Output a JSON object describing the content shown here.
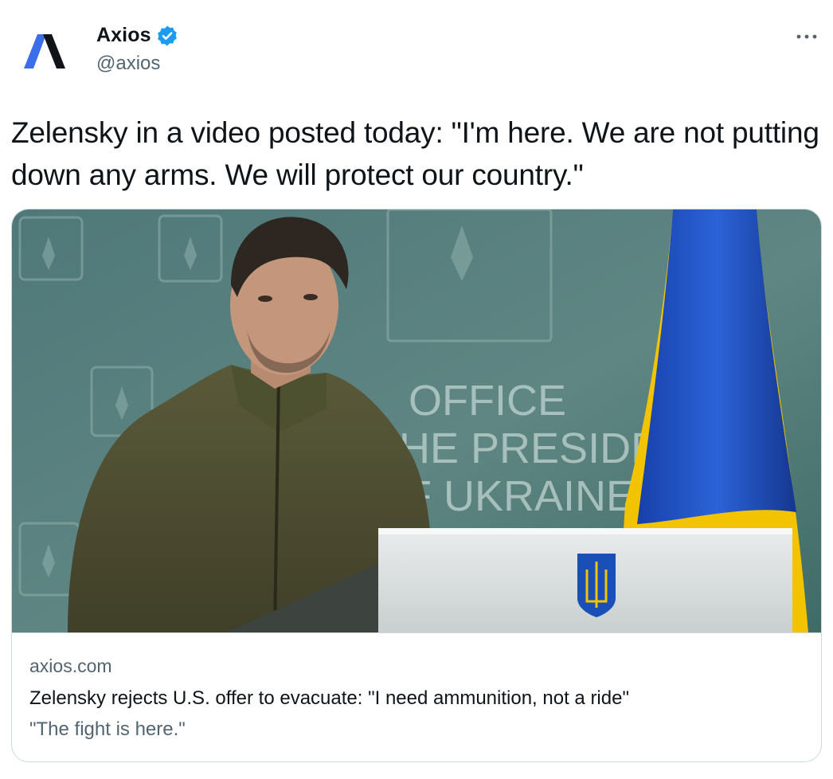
{
  "author": {
    "display_name": "Axios",
    "handle": "@axios",
    "verified": true,
    "avatar_icon": "axios-logo-icon",
    "brand_color": "#3d6ee9"
  },
  "actions": {
    "more_icon": "more-options-icon"
  },
  "tweet": {
    "text": "Zelensky in a video posted today: \"I'm here. We are not putting down any arms. We will protect our country.\""
  },
  "card": {
    "image_alt_text_visible": false,
    "image_signage": {
      "line1": "OFFICE",
      "line2": "HE PRESIDENT",
      "line3": "F UKRAINE"
    },
    "domain": "axios.com",
    "headline": "Zelensky rejects U.S. offer to evacuate: \"I need ammunition, not a ride\"",
    "description": "\"The fight is here.\""
  },
  "colors": {
    "text": "#0f1419",
    "secondary": "#536471",
    "border": "#cfd9de",
    "verified": "#1d9bf0",
    "flag_blue": "#1f56c8",
    "flag_yellow": "#f2c300"
  }
}
